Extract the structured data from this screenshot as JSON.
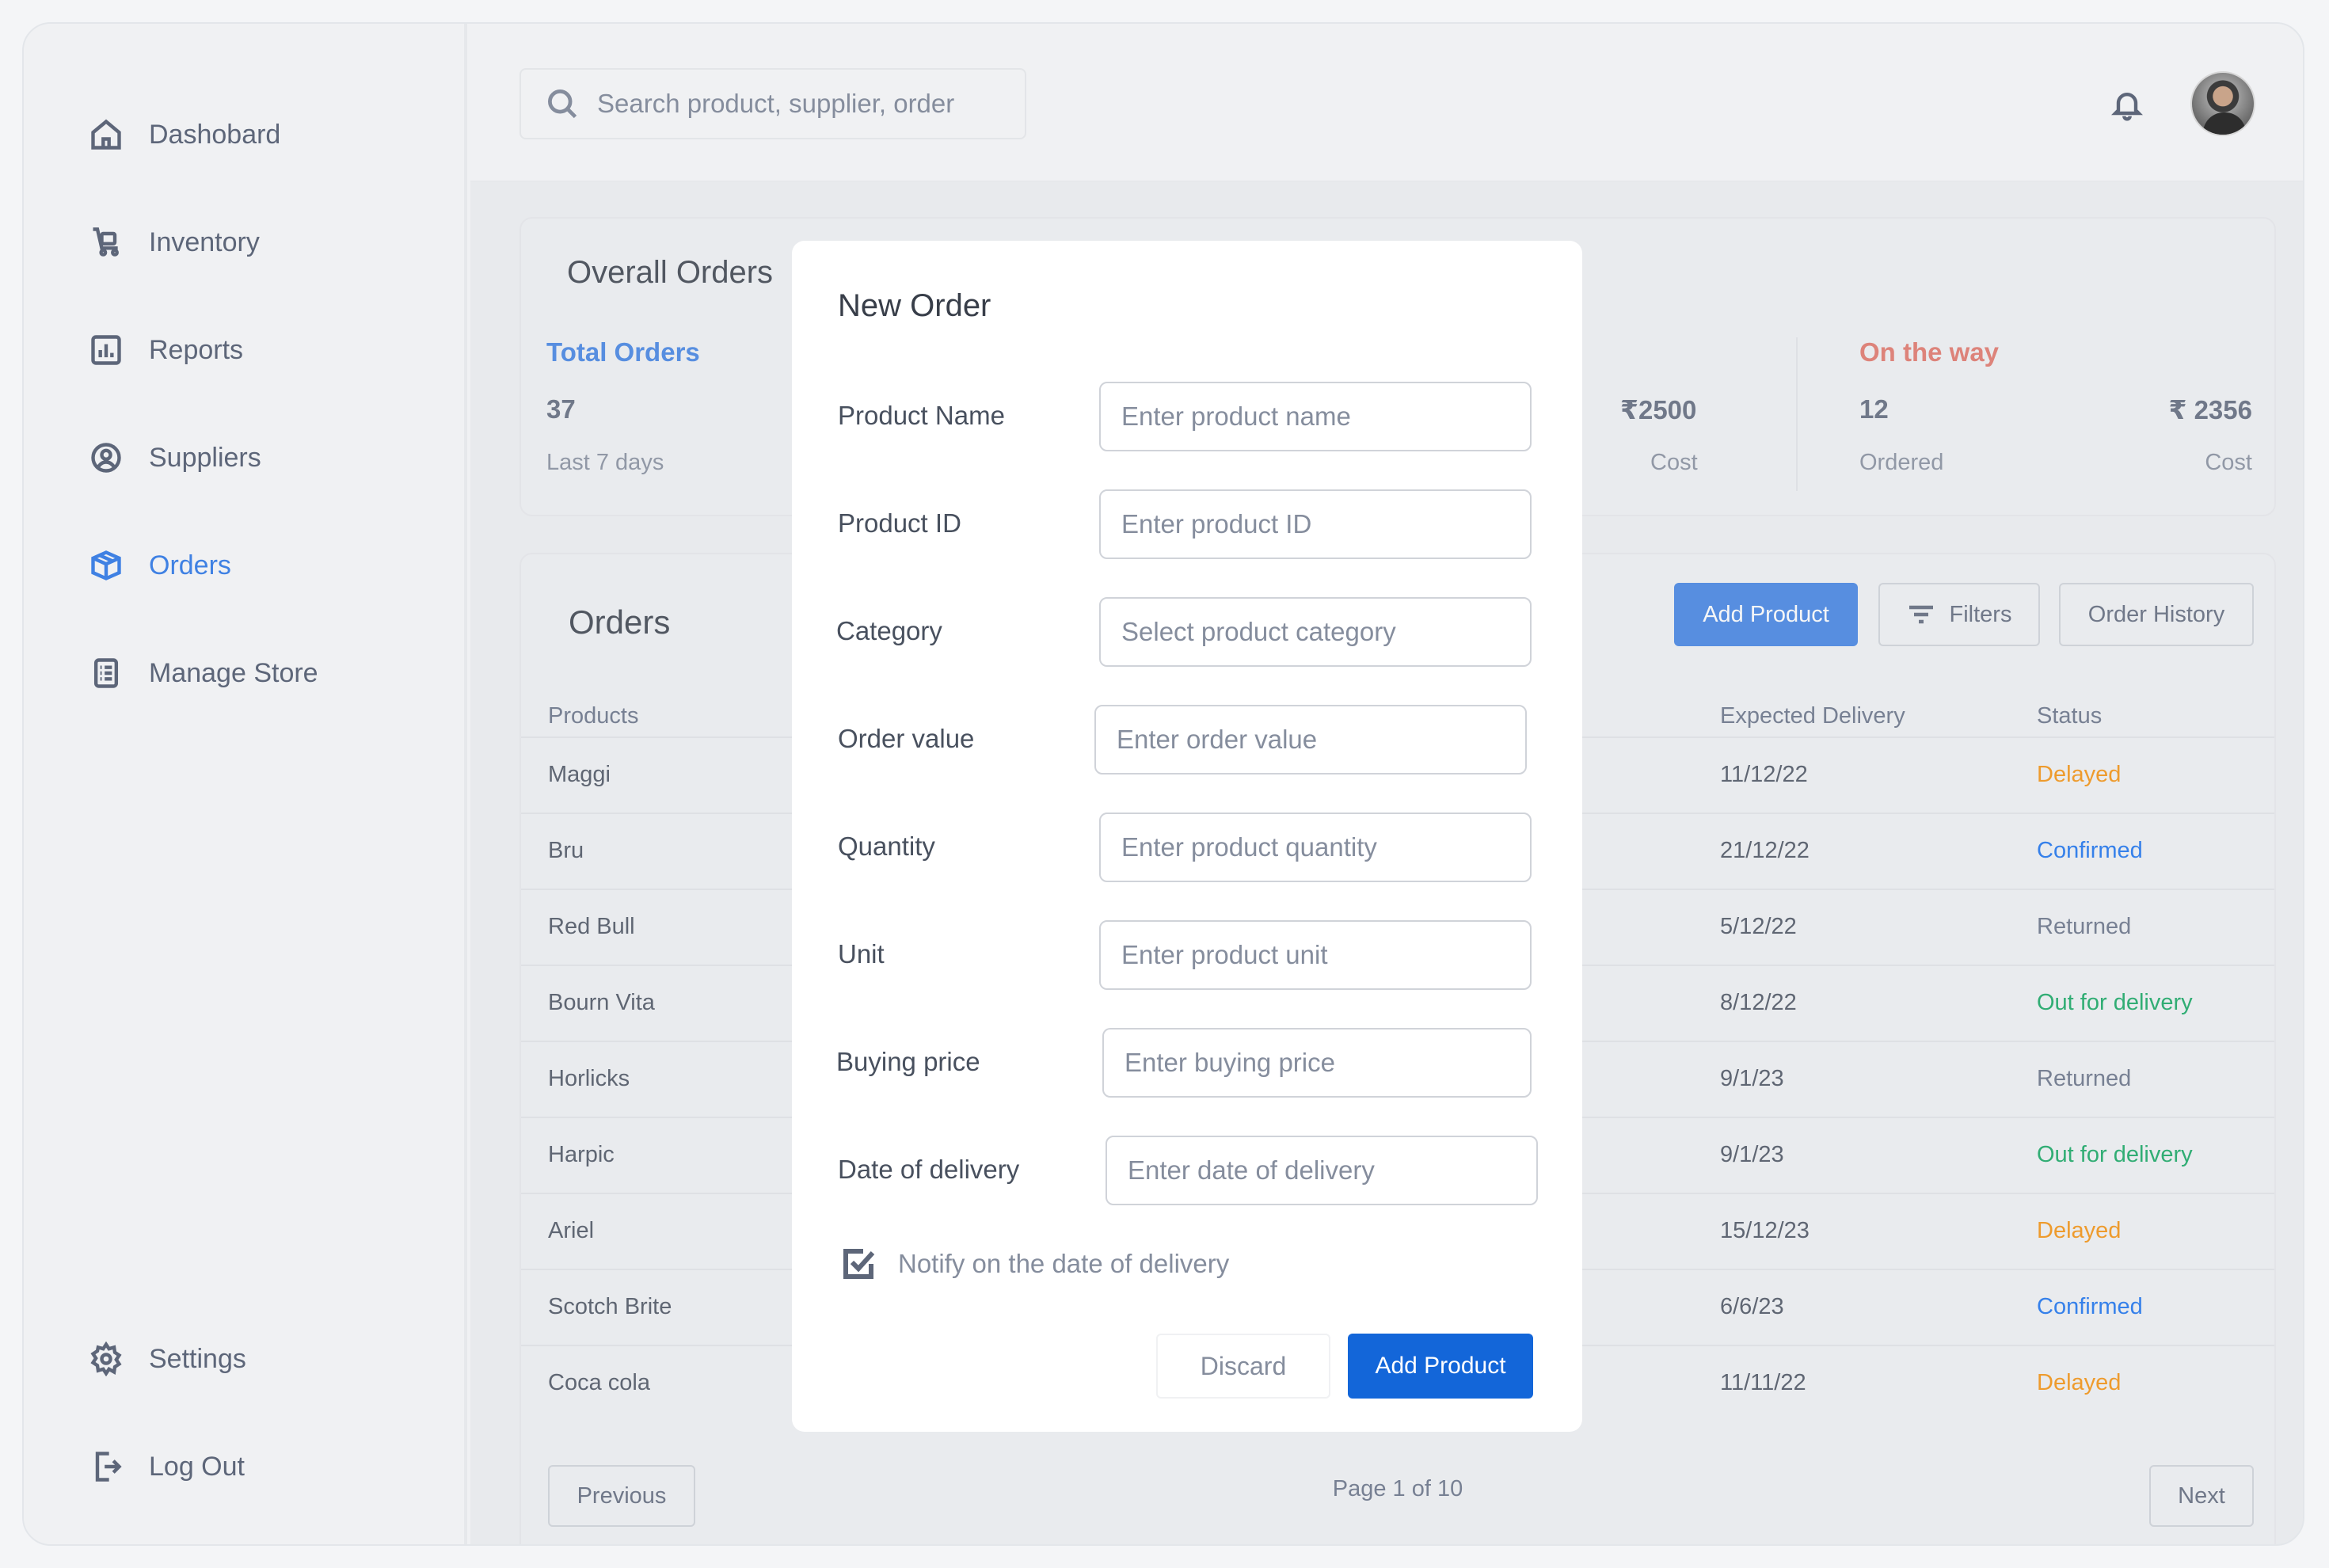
{
  "sidebar": {
    "items": [
      {
        "label": "Dashobard",
        "icon": "home-icon"
      },
      {
        "label": "Inventory",
        "icon": "trolley-icon"
      },
      {
        "label": "Reports",
        "icon": "bar-chart-icon"
      },
      {
        "label": "Suppliers",
        "icon": "user-circle-icon"
      },
      {
        "label": "Orders",
        "icon": "box-icon",
        "active": true
      },
      {
        "label": "Manage Store",
        "icon": "clipboard-icon"
      }
    ],
    "bottom": [
      {
        "label": "Settings",
        "icon": "gear-icon"
      },
      {
        "label": "Log Out",
        "icon": "logout-icon"
      }
    ]
  },
  "header": {
    "search_placeholder": "Search product, supplier, order"
  },
  "overall": {
    "title": "Overall Orders",
    "total_orders": {
      "label": "Total Orders",
      "value": "37",
      "sub": "Last 7 days"
    },
    "partial_cost": {
      "value": "₹2500",
      "sub": "Cost"
    },
    "on_the_way": {
      "label": "On the way",
      "ordered_value": "12",
      "ordered_sub": "Ordered",
      "cost_value": "₹ 2356",
      "cost_sub": "Cost"
    }
  },
  "orders": {
    "title": "Orders",
    "add_product": "Add Product",
    "filters": "Filters",
    "order_history": "Order History",
    "columns": {
      "products": "Products",
      "expected_delivery": "Expected Delivery",
      "status": "Status"
    },
    "rows": [
      {
        "product": "Maggi",
        "delivery": "11/12/22",
        "status": "Delayed"
      },
      {
        "product": "Bru",
        "delivery": "21/12/22",
        "status": "Confirmed"
      },
      {
        "product": "Red Bull",
        "delivery": "5/12/22",
        "status": "Returned"
      },
      {
        "product": "Bourn Vita",
        "delivery": "8/12/22",
        "status": "Out for delivery"
      },
      {
        "product": "Horlicks",
        "delivery": "9/1/23",
        "status": "Returned"
      },
      {
        "product": "Harpic",
        "delivery": "9/1/23",
        "status": "Out for delivery"
      },
      {
        "product": "Ariel",
        "delivery": "15/12/23",
        "status": "Delayed"
      },
      {
        "product": "Scotch Brite",
        "delivery": "6/6/23",
        "status": "Confirmed"
      },
      {
        "product": "Coca cola",
        "delivery": "11/11/22",
        "status": "Delayed"
      }
    ],
    "previous": "Previous",
    "next": "Next",
    "page_text": "Page 1 of 10"
  },
  "modal": {
    "title": "New Order",
    "fields": [
      {
        "label": "Product Name",
        "placeholder": "Enter product name"
      },
      {
        "label": "Product ID",
        "placeholder": "Enter product ID"
      },
      {
        "label": "Category",
        "placeholder": "Select product category"
      },
      {
        "label": "Order value",
        "placeholder": "Enter order value"
      },
      {
        "label": "Quantity",
        "placeholder": "Enter product quantity"
      },
      {
        "label": "Unit",
        "placeholder": "Enter product unit"
      },
      {
        "label": "Buying price",
        "placeholder": "Enter buying price"
      },
      {
        "label": "Date of delivery",
        "placeholder": "Enter date of delivery"
      }
    ],
    "notify_label": "Notify on the date of delivery",
    "notify_checked": true,
    "discard": "Discard",
    "add_product": "Add Product"
  },
  "colors": {
    "accent": "#3f81e3",
    "primary_button": "#1366d9",
    "delayed": "#f79009",
    "confirmed": "#1570ef",
    "returned": "#667085",
    "out_for_delivery": "#10a760",
    "on_the_way": "#e27367"
  }
}
